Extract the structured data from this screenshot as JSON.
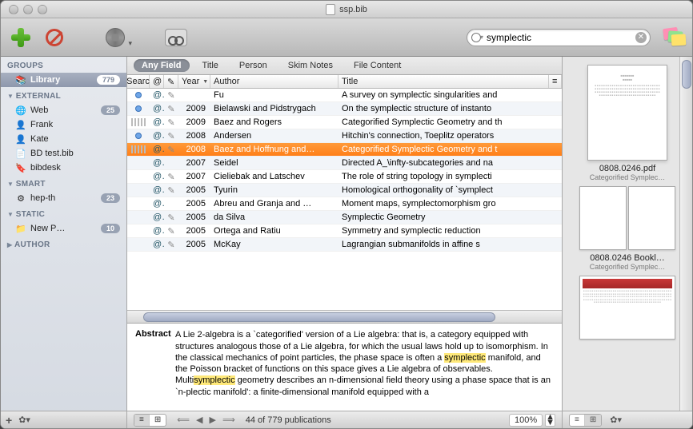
{
  "title": "ssp.bib",
  "search": {
    "value": "symplectic"
  },
  "filters": {
    "any_field": "Any Field",
    "title": "Title",
    "person": "Person",
    "skim": "Skim Notes",
    "file": "File Content"
  },
  "sidebar": {
    "groups_hdr": "GROUPS",
    "library": {
      "label": "Library",
      "count": "779"
    },
    "external_hdr": "EXTERNAL",
    "external": [
      {
        "label": "Web",
        "count": "25",
        "ico": "🌐"
      },
      {
        "label": "Frank",
        "count": "",
        "ico": "👤"
      },
      {
        "label": "Kate",
        "count": "",
        "ico": "👤"
      },
      {
        "label": "BD test.bib",
        "count": "",
        "ico": "📄"
      },
      {
        "label": "bibdesk",
        "count": "",
        "ico": "🔖"
      }
    ],
    "smart_hdr": "SMART",
    "smart": [
      {
        "label": "hep-th",
        "count": "23",
        "ico": "⚙"
      }
    ],
    "static_hdr": "STATIC",
    "static": [
      {
        "label": "New P…",
        "count": "10",
        "ico": "📁"
      }
    ],
    "author_hdr": "AUTHOR"
  },
  "columns": {
    "search": "Searc",
    "at": "@",
    "pen": "✎",
    "year": "Year",
    "author": "Author",
    "title": "Title"
  },
  "rows": [
    {
      "read": "dot",
      "at": true,
      "pen": true,
      "year": "",
      "author": "Fu",
      "title": "A survey on symplectic singularities and"
    },
    {
      "read": "dot",
      "at": true,
      "pen": true,
      "year": "2009",
      "author": "Bielawski and Pidstrygach",
      "title": "On the symplectic structure of instanto"
    },
    {
      "read": "bars",
      "at": true,
      "pen": true,
      "year": "2009",
      "author": "Baez and Rogers",
      "title": "Categorified Symplectic Geometry and th"
    },
    {
      "read": "dot",
      "at": true,
      "pen": true,
      "year": "2008",
      "author": "Andersen",
      "title": "Hitchin's connection, Toeplitz operators"
    },
    {
      "read": "bars",
      "at": true,
      "pen": true,
      "year": "2008",
      "author": "Baez and Hoffnung and…",
      "title": "Categorified Symplectic Geometry and t",
      "sel": true
    },
    {
      "read": "",
      "at": true,
      "pen": false,
      "year": "2007",
      "author": "Seidel",
      "title": "Directed A_\\infty-subcategories and na"
    },
    {
      "read": "",
      "at": true,
      "pen": true,
      "year": "2007",
      "author": "Cieliebak and Latschev",
      "title": "The role of string topology in symplecti"
    },
    {
      "read": "",
      "at": true,
      "pen": true,
      "year": "2005",
      "author": "Tyurin",
      "title": "Homological orthogonality of `symplect"
    },
    {
      "read": "",
      "at": true,
      "pen": false,
      "year": "2005",
      "author": "Abreu and Granja and …",
      "title": "Moment maps, symplectomorphism gro"
    },
    {
      "read": "",
      "at": true,
      "pen": true,
      "year": "2005",
      "author": "da Silva",
      "title": "Symplectic Geometry"
    },
    {
      "read": "",
      "at": true,
      "pen": true,
      "year": "2005",
      "author": "Ortega and Ratiu",
      "title": "Symmetry and symplectic reduction"
    },
    {
      "read": "",
      "at": true,
      "pen": true,
      "year": "2005",
      "author": "McKay",
      "title": "Lagrangian submanifolds in affine s"
    }
  ],
  "abstract": {
    "heading": "Abstract",
    "text_pre": "A Lie 2-algebra is a `categorified' version of a Lie algebra: that is, a category equipped with structures analogous those of a Lie algebra, for which the usual laws hold up to isomorphism. In the classical mechanics of point particles, the phase space is often a ",
    "hl1": "symplectic",
    "text_mid": " manifold, and the Poisson bracket of functions on this space gives a Lie algebra of observables. Multi",
    "hl2": "symplectic",
    "text_post": " geometry describes an n-dimensional field theory using a phase space that is an `n-plectic manifold': a finite-dimensional manifold equipped with a"
  },
  "status": {
    "count": "44 of 779 publications",
    "zoom": "100%"
  },
  "preview": [
    {
      "name": "0808.0246.pdf",
      "sub": "Categorified Symplec…",
      "kind": "page"
    },
    {
      "name": "0808.0246 Bookl…",
      "sub": "Categorified Symplec…",
      "kind": "pages"
    },
    {
      "name": "",
      "sub": "",
      "kind": "web"
    }
  ]
}
